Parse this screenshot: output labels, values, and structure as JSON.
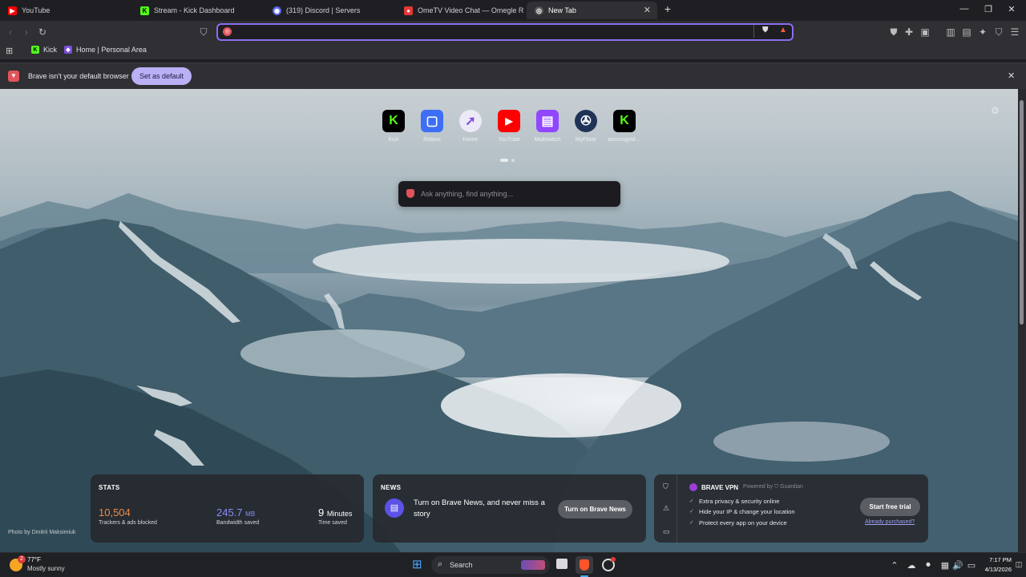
{
  "tabs": [
    {
      "title": "YouTube",
      "icon": "youtube-icon",
      "color": "#ff0000"
    },
    {
      "title": "Stream - Kick Dashboard",
      "icon": "kick-icon",
      "color": "#53fc18"
    },
    {
      "title": "(319) Discord | Servers",
      "icon": "discord-icon",
      "color": "#5865f2"
    },
    {
      "title": "OmeTV Video Chat — Omegle R",
      "icon": "ometv-icon",
      "color": "#e53935"
    },
    {
      "title": "New Tab",
      "icon": "brave-icon",
      "color": "#aaaaaa"
    }
  ],
  "url": {
    "value": ""
  },
  "bookmarks": [
    {
      "label": "Kick",
      "icon": "kick-icon",
      "color": "#53fc18"
    },
    {
      "label": "Home | Personal Area",
      "icon": "fx-icon",
      "color": "#7b4fd8"
    }
  ],
  "infobar": {
    "message": "Brave isn't your default browser",
    "button": "Set as default"
  },
  "top_sites": [
    {
      "label": "Kick",
      "glyph": "K",
      "bg": "#000000",
      "fg": "#53fc18"
    },
    {
      "label": "Roblox",
      "glyph": "▢",
      "bg": "#3d6ef5",
      "fg": "#ffffff"
    },
    {
      "label": "Home",
      "glyph": "➚",
      "bg": "#eceaf8",
      "fg": "#7b4fd8"
    },
    {
      "label": "YouTube",
      "glyph": "▶",
      "bg": "#ff0000",
      "fg": "#ffffff"
    },
    {
      "label": "Multitwitch",
      "glyph": "▤",
      "bg": "#9146ff",
      "fg": "#ffffff"
    },
    {
      "label": "MyFlixer",
      "glyph": "✇",
      "bg": "#1e3356",
      "fg": "#ffffff"
    },
    {
      "label": "asmongold…",
      "glyph": "K",
      "bg": "#000000",
      "fg": "#53fc18"
    }
  ],
  "search": {
    "placeholder": "Ask anything, find anything..."
  },
  "stats": {
    "title": "STATS",
    "trackers": {
      "value": "10,504",
      "label": "Trackers & ads blocked",
      "color": "#f08a4b"
    },
    "bandwidth": {
      "value": "245.7",
      "unit": "MB",
      "label": "Bandwidth saved",
      "color": "#8b8cf5"
    },
    "time": {
      "value": "9",
      "unit": "Minutes",
      "label": "Time saved"
    }
  },
  "news": {
    "title": "NEWS",
    "text": "Turn on Brave News, and never miss a story",
    "button": "Turn on Brave News"
  },
  "vpn": {
    "title": "BRAVE VPN",
    "powered": "Powered by",
    "powered_brand": "Guardian",
    "features": [
      "Extra privacy & security online",
      "Hide your IP & change your location",
      "Protect every app on your device"
    ],
    "button": "Start free trial",
    "link": "Already purchased?"
  },
  "photo_credit": "Photo by Dmitrii Maksimiuk",
  "taskbar": {
    "weather_temp": "77°F",
    "weather_desc": "Mostly sunny",
    "weather_badge": "2",
    "search_label": "Search",
    "time": "7:17 PM",
    "date": "4/13/2026"
  }
}
